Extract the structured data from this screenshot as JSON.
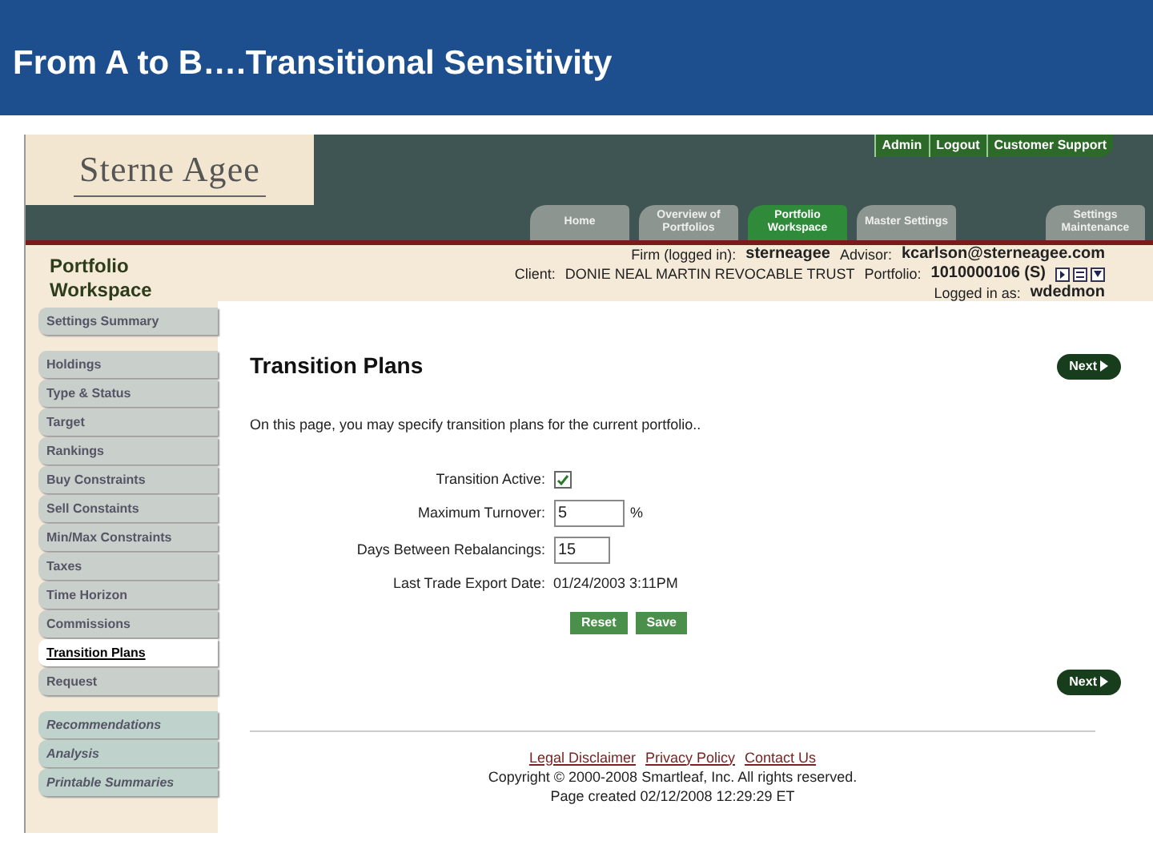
{
  "slide_title": "From A to B….Transitional Sensitivity",
  "header": {
    "logo": "Sterne Agee",
    "top_links": [
      "Admin",
      "Logout",
      "Customer Support"
    ],
    "tabs": [
      {
        "label": "Home",
        "selected": false
      },
      {
        "label": "Overview of Portfolios",
        "selected": false
      },
      {
        "label": "Portfolio Workspace",
        "selected": true
      },
      {
        "label": "Master Settings",
        "selected": false
      },
      {
        "label": "Settings Maintenance",
        "selected": false
      }
    ]
  },
  "info": {
    "section_title": "Portfolio Workspace",
    "firm_label": "Firm (logged in):",
    "firm": "sterneagee",
    "advisor_label": "Advisor:",
    "advisor": "kcarlson@sterneagee.com",
    "client_label": "Client:",
    "client": "DONIE NEAL MARTIN REVOCABLE TRUST",
    "portfolio_label": "Portfolio:",
    "portfolio": "1010000106 (S)",
    "logged_label": "Logged in as:",
    "logged": "wdedmon"
  },
  "sidebar": {
    "groups": [
      {
        "italic": false,
        "items": [
          {
            "label": "Settings Summary",
            "selected": false
          }
        ]
      },
      {
        "italic": false,
        "items": [
          {
            "label": "Holdings",
            "selected": false
          },
          {
            "label": "Type & Status",
            "selected": false
          },
          {
            "label": "Target",
            "selected": false
          },
          {
            "label": "Rankings",
            "selected": false
          },
          {
            "label": "Buy Constraints",
            "selected": false
          },
          {
            "label": "Sell Constaints",
            "selected": false
          },
          {
            "label": "Min/Max Constraints",
            "selected": false
          },
          {
            "label": "Taxes",
            "selected": false
          },
          {
            "label": "Time Horizon",
            "selected": false
          },
          {
            "label": "Commissions",
            "selected": false
          },
          {
            "label": "Transition Plans",
            "selected": true
          },
          {
            "label": "Request",
            "selected": false
          }
        ]
      },
      {
        "italic": true,
        "items": [
          {
            "label": "Recommendations",
            "selected": false
          },
          {
            "label": "Analysis",
            "selected": false
          },
          {
            "label": "Printable Summaries",
            "selected": false
          }
        ]
      }
    ]
  },
  "content": {
    "title": "Transition Plans",
    "next_button": "Next",
    "intro": "On this page, you may specify transition plans for the current portfolio..",
    "fields": [
      {
        "kind": "checkbox",
        "label": "Transition Active:",
        "checked": true
      },
      {
        "kind": "input",
        "label": "Maximum Turnover:",
        "value": "5",
        "unit": "%"
      },
      {
        "kind": "input",
        "label": "Days Between Rebalancings:",
        "value": "15"
      },
      {
        "kind": "text",
        "label": "Last Trade Export Date:",
        "value": "01/24/2003 3:11PM"
      }
    ],
    "buttons": [
      "Reset",
      "Save"
    ],
    "bottom_next_button": "Next"
  },
  "footer": {
    "links": [
      "Legal Disclaimer",
      "Privacy Policy",
      "Contact Us"
    ],
    "copyright": "Copyright © 2000-2008 Smartleaf, Inc. All rights reserved.",
    "page_created": "Page created 02/12/2008 12:29:29 ET"
  }
}
